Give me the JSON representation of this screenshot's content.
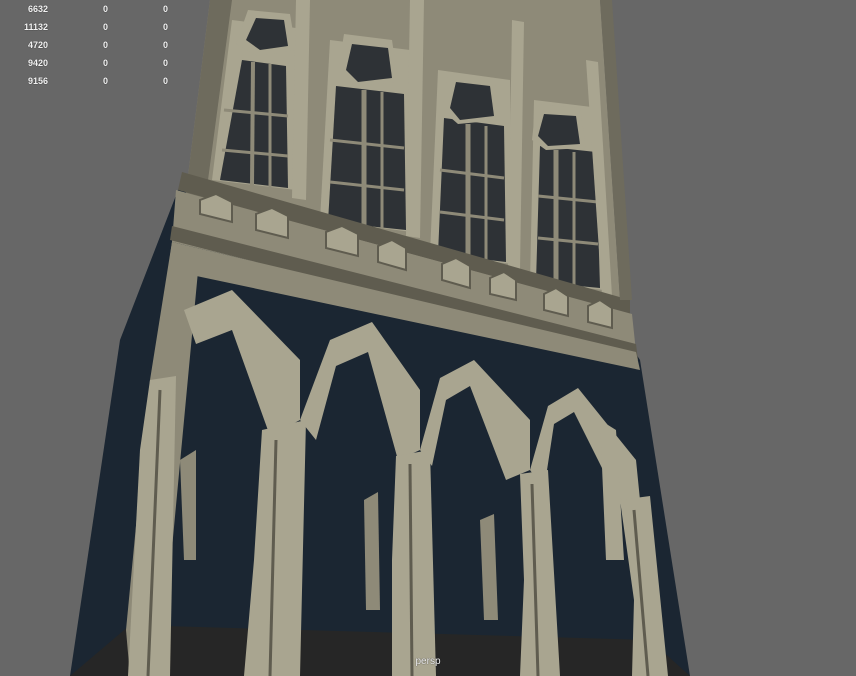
{
  "hud": {
    "rows": [
      [
        "6632",
        "0",
        "0"
      ],
      [
        "11132",
        "0",
        "0"
      ],
      [
        "4720",
        "0",
        "0"
      ],
      [
        "9420",
        "0",
        "0"
      ],
      [
        "9156",
        "0",
        "0"
      ]
    ]
  },
  "viewport": {
    "camera_label": "persp"
  },
  "colors": {
    "background": "#676767",
    "stone": "#8e8a78",
    "stone_light": "#a9a590",
    "stone_dark": "#5f5c4f",
    "window": "#2e3236",
    "interior": "#1b2632",
    "floor": "#262626"
  }
}
